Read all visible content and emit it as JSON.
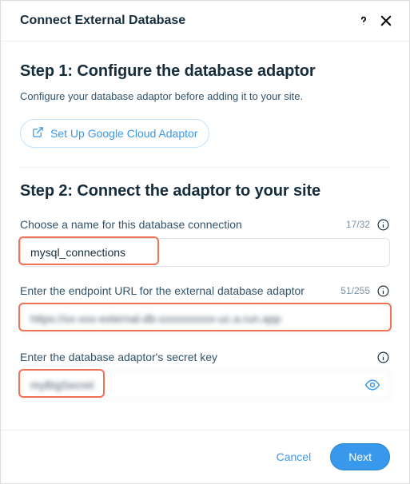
{
  "header": {
    "title": "Connect External Database"
  },
  "step1": {
    "title": "Step 1: Configure the database adaptor",
    "description": "Configure your database adaptor before adding it to your site.",
    "setup_button": "Set Up Google Cloud Adaptor"
  },
  "step2": {
    "title": "Step 2: Connect the adaptor to your site",
    "name": {
      "label": "Choose a name for this database connection",
      "counter": "17/32",
      "value": "mysql_connections"
    },
    "endpoint": {
      "label": "Enter the endpoint URL for the external database adaptor",
      "counter": "51/255",
      "value": "https://xx-xxx-external-db-xxxxxxxxxx-uc.a.run.app"
    },
    "secret": {
      "label": "Enter the database adaptor's secret key",
      "value": "myBigSecret"
    }
  },
  "footer": {
    "cancel": "Cancel",
    "next": "Next"
  }
}
